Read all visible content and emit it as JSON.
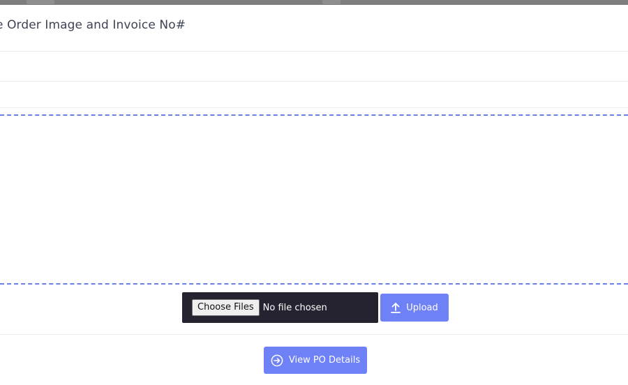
{
  "modal": {
    "title": "e Order Image and Invoice No#"
  },
  "file_input": {
    "choose_label": "Choose Files",
    "status": "No file chosen"
  },
  "upload_button": {
    "label": "Upload",
    "icon": "upload-arrow-icon"
  },
  "view_po_button": {
    "label": "View PO Details",
    "icon": "circle-arrow-right-icon"
  },
  "colors": {
    "accent": "#6f81f7",
    "dropzone_border": "#6b7ee3",
    "file_input_bg": "#24232f",
    "title_text": "#3f4254",
    "divider": "#ebedf3"
  }
}
